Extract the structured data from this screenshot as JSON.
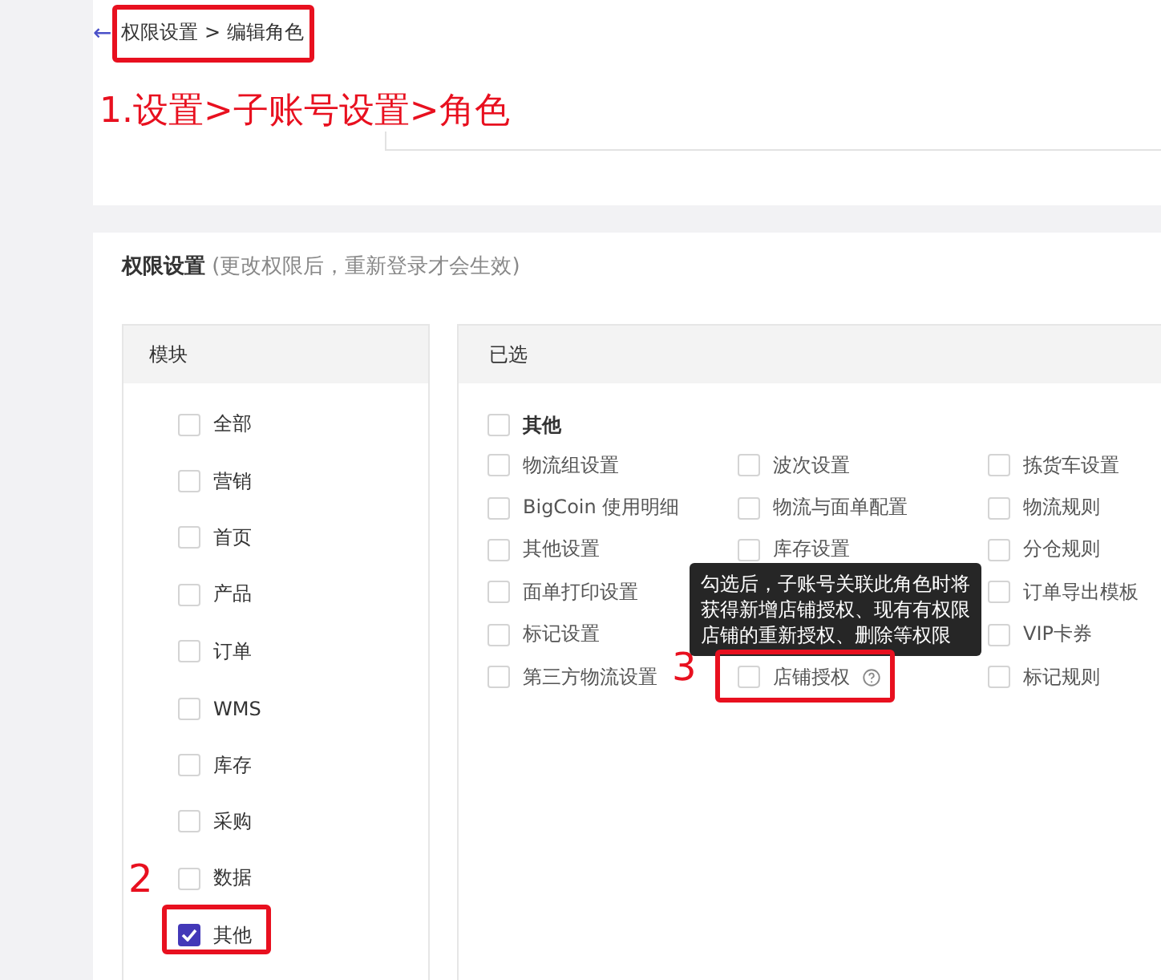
{
  "breadcrumb": {
    "back_icon": "←",
    "path": "权限设置 > 编辑角色"
  },
  "permissions": {
    "title": "权限设置",
    "note": "(更改权限后，重新登录才会生效)",
    "module_header": "模块",
    "selected_header": "已选",
    "modules": [
      {
        "label": "全部",
        "checked": false
      },
      {
        "label": "营销",
        "checked": false
      },
      {
        "label": "首页",
        "checked": false
      },
      {
        "label": "产品",
        "checked": false
      },
      {
        "label": "订单",
        "checked": false
      },
      {
        "label": "WMS",
        "checked": false
      },
      {
        "label": "库存",
        "checked": false
      },
      {
        "label": "采购",
        "checked": false
      },
      {
        "label": "数据",
        "checked": false
      },
      {
        "label": "其他",
        "checked": true
      }
    ],
    "group": {
      "label": "其他",
      "checked": false
    },
    "rows": [
      [
        {
          "label": "物流组设置",
          "checked": false
        },
        {
          "label": "波次设置",
          "checked": false
        },
        {
          "label": "拣货车设置",
          "checked": false
        }
      ],
      [
        {
          "label": "BigCoin 使用明细",
          "checked": false
        },
        {
          "label": "物流与面单配置",
          "checked": false
        },
        {
          "label": "物流规则",
          "checked": false
        }
      ],
      [
        {
          "label": "其他设置",
          "checked": false
        },
        {
          "label": "库存设置",
          "checked": false
        },
        {
          "label": "分仓规则",
          "checked": false
        }
      ],
      [
        {
          "label": "面单打印设置",
          "checked": false
        },
        null,
        {
          "label": "订单导出模板",
          "checked": false
        }
      ],
      [
        {
          "label": "标记设置",
          "checked": false
        },
        null,
        {
          "label": "VIP卡券",
          "checked": false
        }
      ],
      [
        {
          "label": "第三方物流设置",
          "checked": false
        },
        {
          "label": "店铺授权",
          "checked": false,
          "help": true
        },
        {
          "label": "标记规则",
          "checked": false
        }
      ]
    ],
    "tooltip": "勾选后，子账号关联此角色时将获得新增店铺授权、现有有权限店铺的重新授权、删除等权限"
  },
  "annotations": [
    {
      "kind": "caption",
      "text": "1.设置>子账号设置>角色"
    },
    {
      "kind": "step",
      "text": "2"
    },
    {
      "kind": "step",
      "text": "3"
    }
  ]
}
